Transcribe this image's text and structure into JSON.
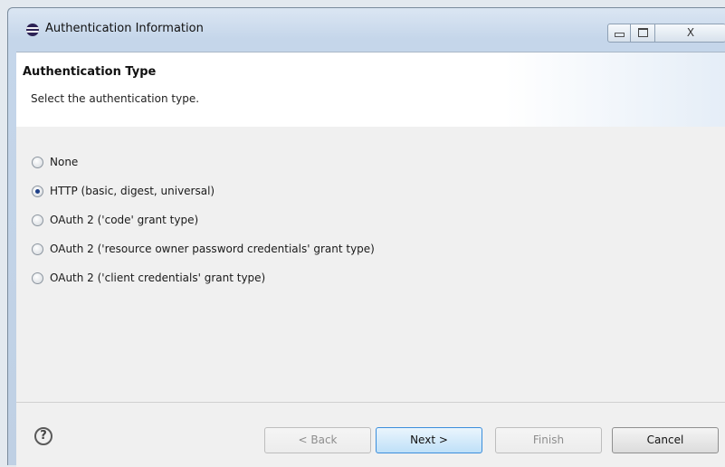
{
  "window": {
    "title": "Authentication Information",
    "controls": {
      "close_label": "X"
    }
  },
  "banner": {
    "title": "Authentication Type",
    "description": "Select the authentication type."
  },
  "options": [
    {
      "label": "None",
      "checked": false
    },
    {
      "label": "HTTP (basic, digest, universal)",
      "checked": true
    },
    {
      "label": "OAuth 2 ('code' grant type)",
      "checked": false
    },
    {
      "label": "OAuth 2 ('resource owner password credentials' grant type)",
      "checked": false
    },
    {
      "label": "OAuth 2 ('client credentials' grant type)",
      "checked": false
    }
  ],
  "footer": {
    "help": "?",
    "back": "< Back",
    "next": "Next >",
    "finish": "Finish",
    "cancel": "Cancel"
  },
  "colors": {
    "accent": "#3b8edb",
    "radio_selected": "#1d3f88"
  }
}
